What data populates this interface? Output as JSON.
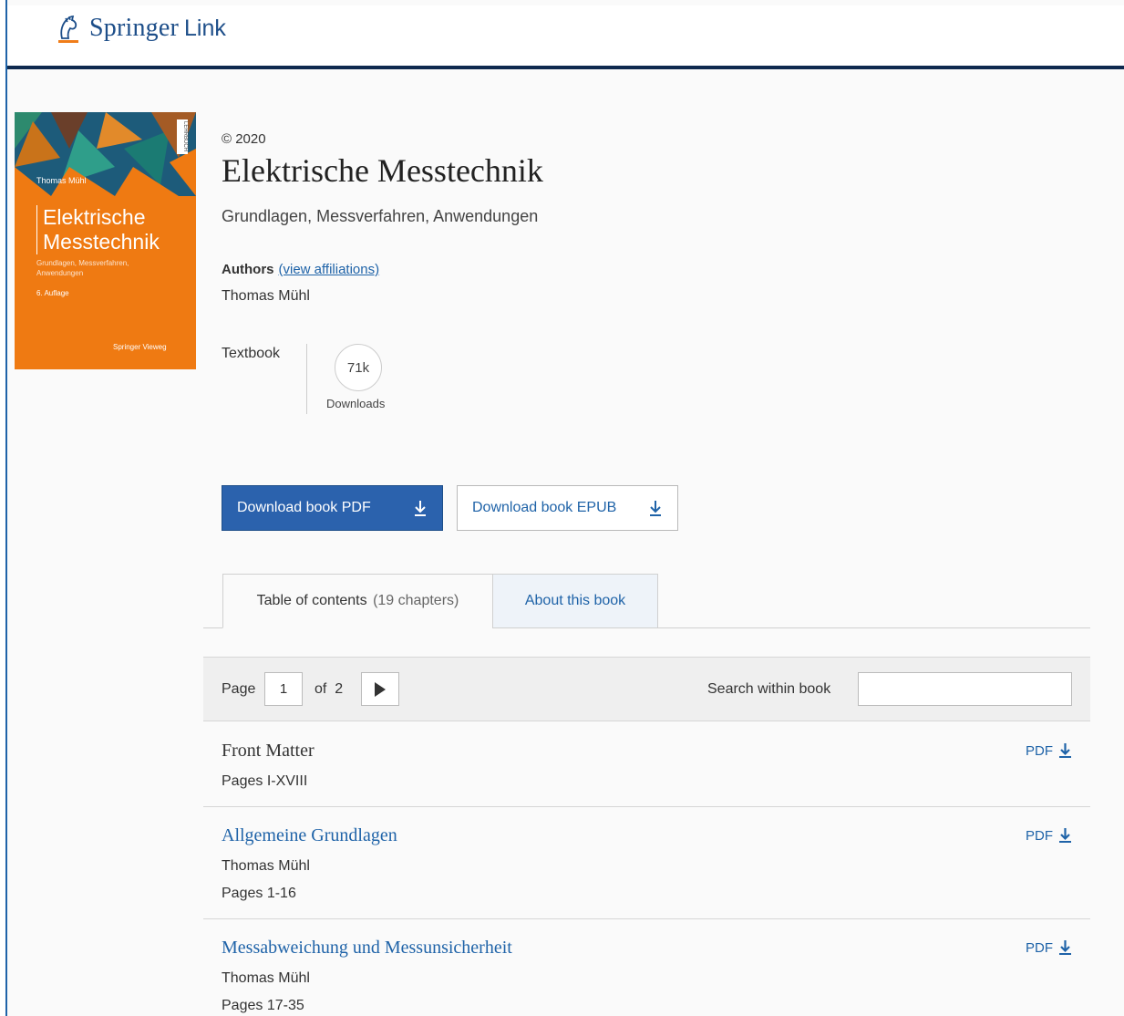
{
  "header": {
    "brand_name": "Springer",
    "brand_suffix": "Link"
  },
  "cover": {
    "author": "Thomas Mühl",
    "title_line1": "Elektrische",
    "title_line2": "Messtechnik",
    "subtitle": "Grundlagen, Messverfahren, Anwendungen",
    "edition": "6. Auflage",
    "publisher": "Springer Vieweg",
    "spine_label": "LEHRBUCH"
  },
  "book": {
    "copyright": "© 2020",
    "title": "Elektrische Messtechnik",
    "subtitle": "Grundlagen, Messverfahren, Anwendungen",
    "authors_heading": "Authors",
    "view_affiliations": "(view affiliations)",
    "author": "Thomas Mühl",
    "type": "Textbook",
    "downloads_count": "71k",
    "downloads_label": "Downloads"
  },
  "actions": {
    "download_pdf": "Download book PDF",
    "download_epub": "Download book EPUB"
  },
  "tabs": {
    "toc_label": "Table of contents",
    "toc_count": "(19 chapters)",
    "about_label": "About this book"
  },
  "pager": {
    "page_label": "Page",
    "current_page": "1",
    "of_label": "of",
    "total_pages": "2",
    "search_label": "Search within book",
    "search_value": ""
  },
  "chapters": [
    {
      "title": "Front Matter",
      "pages": "Pages I-XVIII",
      "pdf_label": "PDF"
    },
    {
      "title": "Allgemeine Grundlagen",
      "author": "Thomas Mühl",
      "pages": "Pages 1-16",
      "pdf_label": "PDF"
    },
    {
      "title": "Messabweichung und Messunsicherheit",
      "author": "Thomas Mühl",
      "pages": "Pages 17-35",
      "pdf_label": "PDF"
    }
  ],
  "colors": {
    "accent": "#1f63a8",
    "primary_button": "#2b62ad",
    "header_border": "#0e2a4f",
    "cover_orange": "#ef7a12"
  }
}
